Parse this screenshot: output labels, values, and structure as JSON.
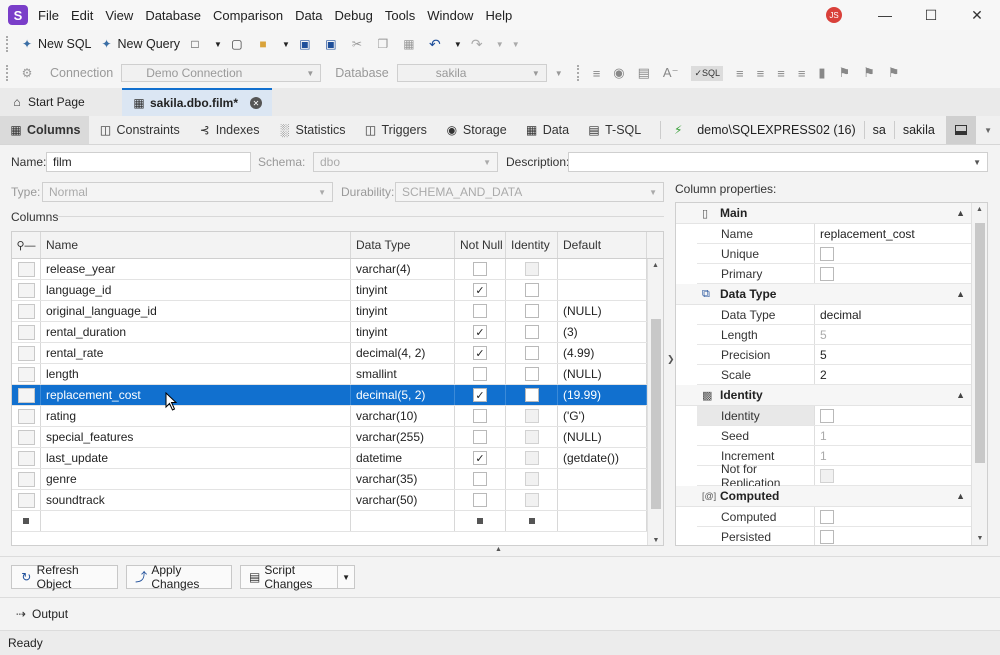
{
  "app": {
    "logo_letter": "S",
    "menu": [
      "File",
      "Edit",
      "View",
      "Database",
      "Comparison",
      "Data",
      "Debug",
      "Tools",
      "Window",
      "Help"
    ],
    "user_initials": "JS"
  },
  "toolbar1": {
    "new_sql": "New SQL",
    "new_query": "New Query"
  },
  "toolbar2": {
    "connection_label": "Connection",
    "connection_value": "Demo Connection",
    "database_label": "Database",
    "database_value": "sakila"
  },
  "doc_tabs": [
    {
      "label": "Start Page",
      "active": false
    },
    {
      "label": "sakila.dbo.film*",
      "active": true
    }
  ],
  "designer_tabs": [
    "Columns",
    "Constraints",
    "Indexes",
    "Statistics",
    "Triggers",
    "Storage",
    "Data",
    "T-SQL"
  ],
  "connection_info": {
    "server": "demo\\SQLEXPRESS02 (16)",
    "user": "sa",
    "database": "sakila"
  },
  "form": {
    "name_label": "Name:",
    "name_value": "film",
    "schema_label": "Schema:",
    "schema_value": "dbo",
    "description_label": "Description:",
    "description_value": "",
    "type_label": "Type:",
    "type_value": "Normal",
    "durability_label": "Durability:",
    "durability_value": "SCHEMA_AND_DATA",
    "columns_label": "Columns",
    "column_properties_label": "Column properties:"
  },
  "grid": {
    "headers": [
      "Name",
      "Data Type",
      "Not Null",
      "Identity",
      "Default"
    ],
    "rows": [
      {
        "name": "release_year",
        "type": "varchar(4)",
        "not_null": false,
        "identity": false,
        "identity_disabled": true,
        "default": ""
      },
      {
        "name": "language_id",
        "type": "tinyint",
        "not_null": true,
        "identity": false,
        "identity_disabled": false,
        "default": ""
      },
      {
        "name": "original_language_id",
        "type": "tinyint",
        "not_null": false,
        "identity": false,
        "identity_disabled": false,
        "default": "(NULL)"
      },
      {
        "name": "rental_duration",
        "type": "tinyint",
        "not_null": true,
        "identity": false,
        "identity_disabled": false,
        "default": "(3)"
      },
      {
        "name": "rental_rate",
        "type": "decimal(4, 2)",
        "not_null": true,
        "identity": false,
        "identity_disabled": false,
        "default": "(4.99)"
      },
      {
        "name": "length",
        "type": "smallint",
        "not_null": false,
        "identity": false,
        "identity_disabled": false,
        "default": "(NULL)"
      },
      {
        "name": "replacement_cost",
        "type": "decimal(5, 2)",
        "not_null": true,
        "identity": false,
        "identity_disabled": false,
        "default": "(19.99)",
        "selected": true
      },
      {
        "name": "rating",
        "type": "varchar(10)",
        "not_null": false,
        "identity": false,
        "identity_disabled": true,
        "default": "('G')"
      },
      {
        "name": "special_features",
        "type": "varchar(255)",
        "not_null": false,
        "identity": false,
        "identity_disabled": true,
        "default": "(NULL)"
      },
      {
        "name": "last_update",
        "type": "datetime",
        "not_null": true,
        "identity": false,
        "identity_disabled": true,
        "default": "(getdate())"
      },
      {
        "name": "genre",
        "type": "varchar(35)",
        "not_null": false,
        "identity": false,
        "identity_disabled": true,
        "default": ""
      },
      {
        "name": "soundtrack",
        "type": "varchar(50)",
        "not_null": false,
        "identity": false,
        "identity_disabled": true,
        "default": ""
      }
    ]
  },
  "properties": {
    "main": {
      "title": "Main",
      "name_label": "Name",
      "name_value": "replacement_cost",
      "unique_label": "Unique",
      "primary_label": "Primary"
    },
    "data_type": {
      "title": "Data Type",
      "type_label": "Data Type",
      "type_value": "decimal",
      "length_label": "Length",
      "length_value": "5",
      "precision_label": "Precision",
      "precision_value": "5",
      "scale_label": "Scale",
      "scale_value": "2"
    },
    "identity": {
      "title": "Identity",
      "identity_label": "Identity",
      "seed_label": "Seed",
      "seed_value": "1",
      "increment_label": "Increment",
      "increment_value": "1",
      "nfr_label": "Not for Replication"
    },
    "computed": {
      "title": "Computed",
      "computed_label": "Computed",
      "persisted_label": "Persisted"
    }
  },
  "buttons": {
    "refresh": "Refresh Object",
    "apply": "Apply Changes",
    "script": "Script Changes"
  },
  "output_label": "Output",
  "status": "Ready",
  "colors": {
    "accent": "#1170cf",
    "logo": "#7a3ec9",
    "user_badge": "#d9403a"
  }
}
